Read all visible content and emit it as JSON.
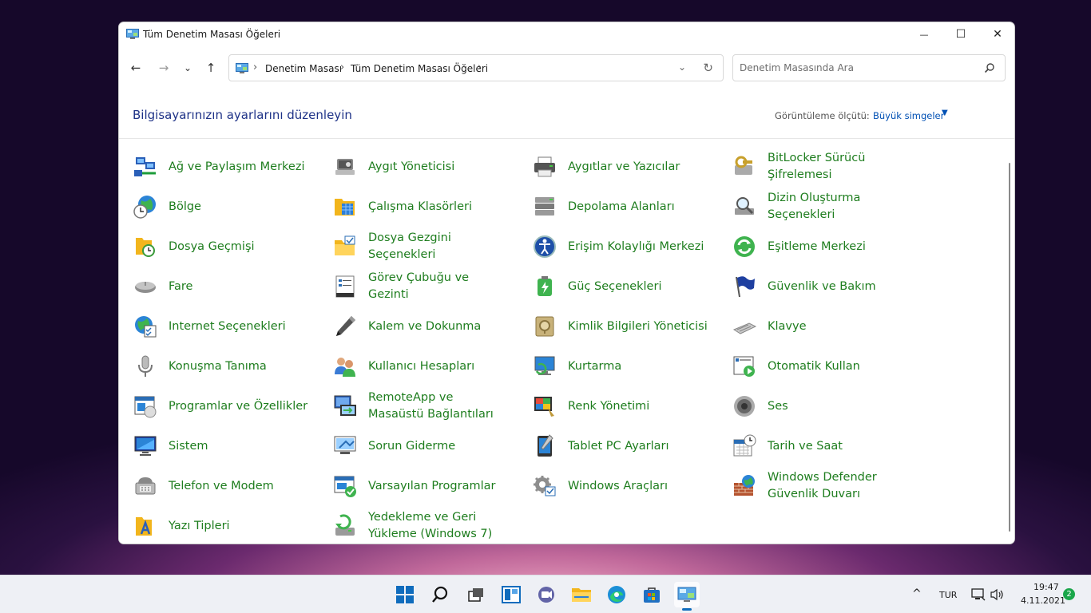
{
  "window": {
    "title": "Tüm Denetim Masası Öğeleri",
    "minimize": "—",
    "maximize": "☐",
    "close": "✕"
  },
  "nav": {
    "back": "←",
    "forward": "→",
    "recent": "⌄",
    "up": "↑",
    "breadcrumbs": [
      "Denetim Masası",
      "Tüm Denetim Masası Öğeleri"
    ],
    "separator": "›",
    "dropdown": "⌄",
    "refresh": "↻"
  },
  "search": {
    "placeholder": "Denetim Masasında Ara",
    "value": ""
  },
  "heading": "Bilgisayarınızın ayarlarını düzenleyin",
  "view_by": {
    "label": "Görüntüleme ölçütü:",
    "value": "Büyük simgeler",
    "arrow": "▼"
  },
  "items": [
    {
      "label": "Ağ ve Paylaşım Merkezi",
      "icon": "network-icon"
    },
    {
      "label": "Aygıt Yöneticisi",
      "icon": "device-manager-icon"
    },
    {
      "label": "Aygıtlar ve Yazıcılar",
      "icon": "printer-icon"
    },
    {
      "label": "BitLocker Sürücü Şifrelemesi",
      "icon": "bitlocker-icon"
    },
    {
      "label": "Bölge",
      "icon": "globe-clock-icon"
    },
    {
      "label": "Çalışma Klasörleri",
      "icon": "work-folders-icon"
    },
    {
      "label": "Depolama Alanları",
      "icon": "storage-icon"
    },
    {
      "label": "Dizin Oluşturma Seçenekleri",
      "icon": "indexing-icon"
    },
    {
      "label": "Dosya Geçmişi",
      "icon": "file-history-icon"
    },
    {
      "label": "Dosya Gezgini Seçenekleri",
      "icon": "folder-options-icon"
    },
    {
      "label": "Erişim Kolaylığı Merkezi",
      "icon": "ease-of-access-icon"
    },
    {
      "label": "Eşitleme Merkezi",
      "icon": "sync-icon"
    },
    {
      "label": "Fare",
      "icon": "mouse-icon"
    },
    {
      "label": "Görev Çubuğu ve Gezinti",
      "icon": "taskbar-icon"
    },
    {
      "label": "Güç Seçenekleri",
      "icon": "power-icon"
    },
    {
      "label": "Güvenlik ve Bakım",
      "icon": "flag-icon"
    },
    {
      "label": "Internet Seçenekleri",
      "icon": "internet-icon"
    },
    {
      "label": "Kalem ve Dokunma",
      "icon": "pen-icon"
    },
    {
      "label": "Kimlik Bilgileri Yöneticisi",
      "icon": "credential-vault-icon"
    },
    {
      "label": "Klavye",
      "icon": "keyboard-icon"
    },
    {
      "label": "Konuşma Tanıma",
      "icon": "microphone-icon"
    },
    {
      "label": "Kullanıcı Hesapları",
      "icon": "users-icon"
    },
    {
      "label": "Kurtarma",
      "icon": "recovery-icon"
    },
    {
      "label": "Otomatik Kullan",
      "icon": "autoplay-icon"
    },
    {
      "label": "Programlar ve Özellikler",
      "icon": "programs-icon"
    },
    {
      "label": "RemoteApp ve Masaüstü Bağlantıları",
      "icon": "remoteapp-icon"
    },
    {
      "label": "Renk Yönetimi",
      "icon": "color-management-icon"
    },
    {
      "label": "Ses",
      "icon": "speaker-icon"
    },
    {
      "label": "Sistem",
      "icon": "system-icon"
    },
    {
      "label": "Sorun Giderme",
      "icon": "troubleshoot-icon"
    },
    {
      "label": "Tablet PC Ayarları",
      "icon": "tablet-icon"
    },
    {
      "label": "Tarih ve Saat",
      "icon": "calendar-clock-icon"
    },
    {
      "label": "Telefon ve Modem",
      "icon": "phone-icon"
    },
    {
      "label": "Varsayılan Programlar",
      "icon": "default-programs-icon"
    },
    {
      "label": "Windows Araçları",
      "icon": "gears-icon"
    },
    {
      "label": "Windows Defender Güvenlik Duvarı",
      "icon": "firewall-icon"
    },
    {
      "label": "Yazı Tipleri",
      "icon": "fonts-icon"
    },
    {
      "label": "Yedekleme ve Geri Yükleme (Windows 7)",
      "icon": "backup-icon"
    }
  ],
  "taskbar": {
    "apps": [
      "start-icon",
      "search-icon",
      "task-view-icon",
      "widgets-icon",
      "chat-icon",
      "file-explorer-icon",
      "edge-icon",
      "store-icon",
      "control-panel-icon"
    ],
    "tray": {
      "chevron": "^",
      "language": "TUR",
      "time": "19:47",
      "date": "4.11.2021",
      "notifications": "2"
    }
  },
  "colors": {
    "item_text": "#1e7d1e",
    "heading": "#1e3287",
    "link": "#0050b4",
    "badge": "#1aa64a"
  }
}
